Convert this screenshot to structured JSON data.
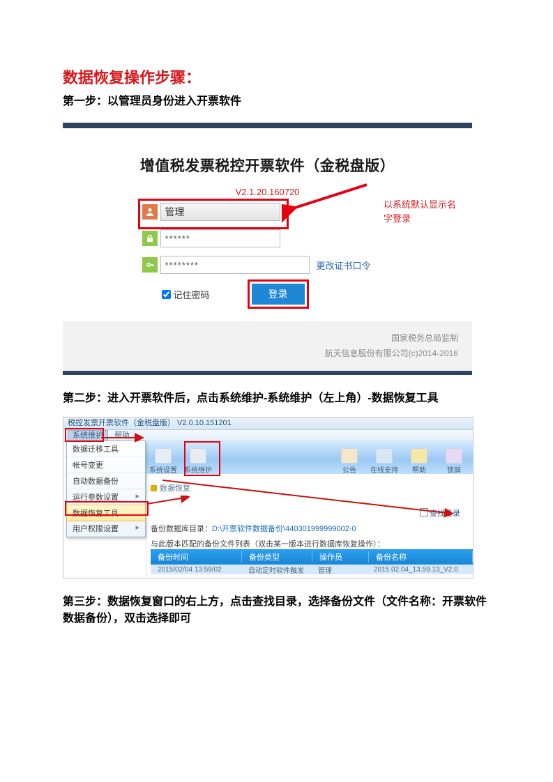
{
  "doc": {
    "title": "数据恢复操作步骤：",
    "step1": "第一步：以管理员身份进入开票软件",
    "step2": "第二步：进入开票软件后，点击系统维护-系统维护（左上角）-数据恢复工具",
    "step3": "第三步：数据恢复窗口的右上方，点击查找目录，选择备份文件（文件名称：开票软件数据备份），双击选择即可"
  },
  "login": {
    "title": "增值税发票税控开票软件（金税盘版）",
    "version": "V2.1.20.160720",
    "user": "管理",
    "pass": "******",
    "cert": "********",
    "cert_link": "更改证书口令",
    "remember": "记住密码",
    "button": "登录",
    "note_line1": "以系统默认显示名",
    "note_line2": "字登录",
    "footer1": "国家税务总局监制",
    "footer2": "航天信息股份有限公司(c)2014-2016"
  },
  "shot2": {
    "titlebar": "税控发票开票软件（金税盘版） V2.0.10.151201",
    "menu_sys": "系统维护",
    "menu_help": "帮助",
    "dd": {
      "i1": "数据迁移工具",
      "i2": "帐号变更",
      "i3": "自动数据备份",
      "i4": "运行参数设置",
      "i5": "数据恢复工具",
      "i6": "用户权限设置"
    },
    "tool_left1": "系统设置",
    "tool_left2": "系统维护",
    "tool_r1": "公告",
    "tool_r2": "在线支持",
    "tool_r3": "帮助",
    "tool_r4": "锁屏",
    "crumb": "数据恢复",
    "findlink": "查找目录",
    "path_label": "备份数据库目录：",
    "path_value": "D:\\开票软件数据备份\\440301999999002-0",
    "subtitle": "与此版本匹配的备份文件列表（双击某一版本进行数据库恢复操作）：",
    "thead": {
      "c1": "备份时间",
      "c2": "备份类型",
      "c3": "操作员",
      "c4": "备份名称"
    },
    "row": {
      "c1": "2015/02/04 13:59/02",
      "c2": "自动定时软件触发",
      "c3": "管理",
      "c4": "2015.02.04_13.59.13_V2.0"
    }
  }
}
